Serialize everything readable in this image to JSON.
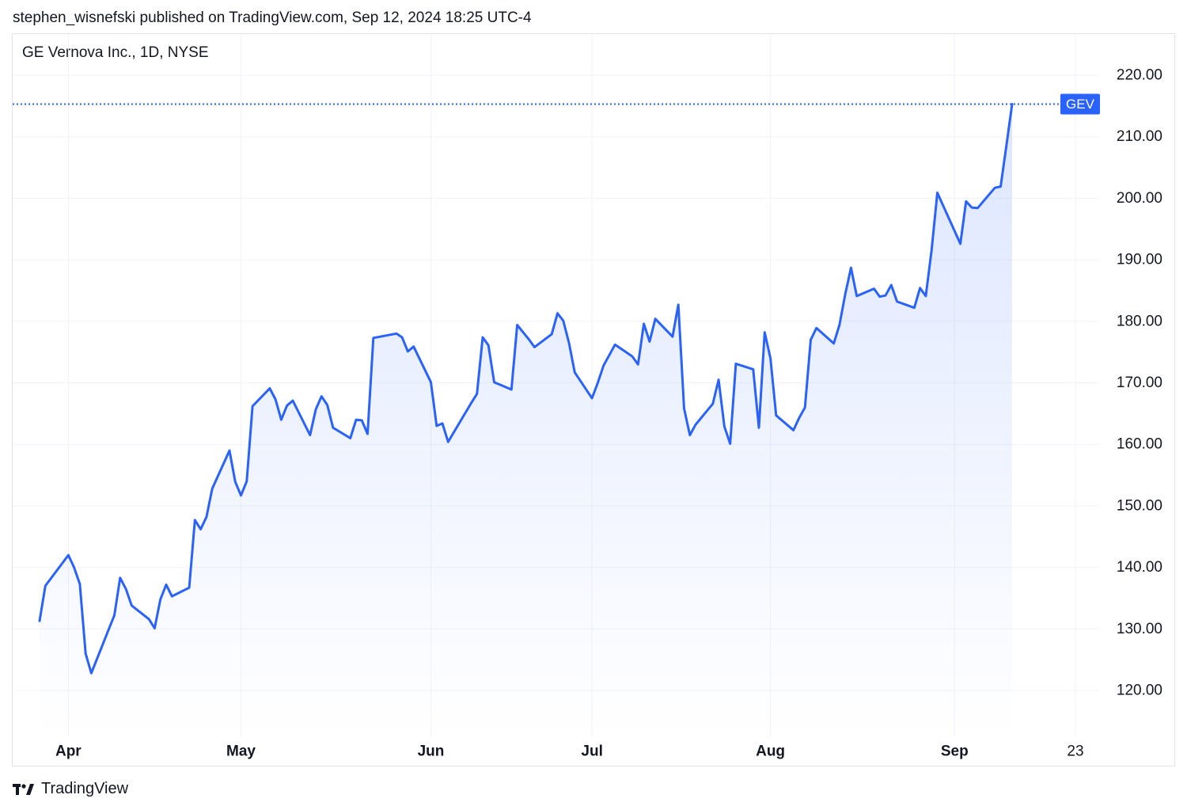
{
  "header": {
    "text": "stephen_wisnefski published on TradingView.com, Sep 12, 2024 18:25 UTC-4"
  },
  "symbol": {
    "title": "GE Vernova Inc., 1D, NYSE",
    "ticker": "GEV"
  },
  "footer": {
    "brand": "TradingView",
    "logo_icon": "tradingview-logo-icon"
  },
  "colors": {
    "line": "#2962ff",
    "grid": "#f0f3fa",
    "text": "#131722",
    "label_bg": "#2962ff"
  },
  "chart_data": {
    "type": "area",
    "series": [
      {
        "name": "GEV",
        "x": [
          "2024-03-27",
          "2024-03-28",
          "2024-04-01",
          "2024-04-02",
          "2024-04-03",
          "2024-04-04",
          "2024-04-05",
          "2024-04-08",
          "2024-04-09",
          "2024-04-10",
          "2024-04-11",
          "2024-04-12",
          "2024-04-15",
          "2024-04-16",
          "2024-04-17",
          "2024-04-18",
          "2024-04-19",
          "2024-04-22",
          "2024-04-23",
          "2024-04-24",
          "2024-04-25",
          "2024-04-26",
          "2024-04-29",
          "2024-04-30",
          "2024-05-01",
          "2024-05-02",
          "2024-05-03",
          "2024-05-06",
          "2024-05-07",
          "2024-05-08",
          "2024-05-09",
          "2024-05-10",
          "2024-05-13",
          "2024-05-14",
          "2024-05-15",
          "2024-05-16",
          "2024-05-17",
          "2024-05-20",
          "2024-05-21",
          "2024-05-22",
          "2024-05-23",
          "2024-05-24",
          "2024-05-28",
          "2024-05-29",
          "2024-05-30",
          "2024-05-31",
          "2024-06-03",
          "2024-06-04",
          "2024-06-05",
          "2024-06-06",
          "2024-06-07",
          "2024-06-10",
          "2024-06-11",
          "2024-06-12",
          "2024-06-13",
          "2024-06-14",
          "2024-06-17",
          "2024-06-18",
          "2024-06-20",
          "2024-06-21",
          "2024-06-24",
          "2024-06-25",
          "2024-06-26",
          "2024-06-27",
          "2024-06-28",
          "2024-07-01",
          "2024-07-02",
          "2024-07-03",
          "2024-07-05",
          "2024-07-08",
          "2024-07-09",
          "2024-07-10",
          "2024-07-11",
          "2024-07-12",
          "2024-07-15",
          "2024-07-16",
          "2024-07-17",
          "2024-07-18",
          "2024-07-19",
          "2024-07-22",
          "2024-07-23",
          "2024-07-24",
          "2024-07-25",
          "2024-07-26",
          "2024-07-29",
          "2024-07-30",
          "2024-07-31",
          "2024-08-01",
          "2024-08-02",
          "2024-08-05",
          "2024-08-06",
          "2024-08-07",
          "2024-08-08",
          "2024-08-09",
          "2024-08-12",
          "2024-08-13",
          "2024-08-14",
          "2024-08-15",
          "2024-08-16",
          "2024-08-19",
          "2024-08-20",
          "2024-08-21",
          "2024-08-22",
          "2024-08-23",
          "2024-08-26",
          "2024-08-27",
          "2024-08-28",
          "2024-08-29",
          "2024-08-30",
          "2024-09-03",
          "2024-09-04",
          "2024-09-05",
          "2024-09-06",
          "2024-09-09",
          "2024-09-10",
          "2024-09-11",
          "2024-09-12"
        ],
        "values": [
          131.3,
          137.0,
          142.0,
          140.0,
          137.3,
          126.0,
          122.8,
          129.9,
          132.2,
          138.3,
          136.5,
          133.8,
          131.6,
          130.1,
          134.8,
          137.2,
          135.3,
          136.7,
          147.7,
          146.2,
          148.2,
          152.8,
          159.0,
          153.9,
          151.7,
          154.0,
          166.2,
          169.1,
          167.3,
          164.0,
          166.3,
          167.1,
          161.5,
          165.7,
          167.8,
          166.4,
          162.7,
          161.0,
          164.0,
          163.9,
          161.7,
          177.3,
          178.0,
          177.4,
          175.1,
          175.9,
          170.1,
          163.0,
          163.4,
          160.4,
          162.0,
          166.7,
          168.2,
          177.4,
          176.1,
          170.1,
          168.9,
          179.4,
          177.1,
          175.8,
          177.9,
          181.3,
          180.1,
          176.5,
          171.7,
          167.5,
          170.0,
          172.8,
          176.2,
          174.3,
          173.0,
          179.6,
          176.7,
          180.4,
          177.5,
          182.7,
          165.8,
          161.5,
          163.2,
          166.6,
          170.5,
          162.9,
          160.1,
          173.1,
          172.2,
          162.7,
          178.2,
          174.0,
          164.7,
          162.3,
          164.3,
          166.0,
          177.0,
          178.9,
          176.4,
          179.4,
          184.4,
          188.7,
          184.1,
          185.3,
          184.0,
          184.2,
          185.9,
          183.2,
          182.2,
          185.4,
          184.1,
          191.5,
          200.9,
          192.6,
          199.5,
          198.5,
          198.4,
          201.7,
          201.9,
          208.5,
          215.3
        ]
      }
    ],
    "x_ticks": [
      "Apr",
      "May",
      "Jun",
      "Jul",
      "Aug",
      "Sep",
      "23"
    ],
    "y_ticks": [
      "120.00",
      "130.00",
      "140.00",
      "150.00",
      "160.00",
      "170.00",
      "180.00",
      "190.00",
      "200.00",
      "210.00",
      "220.00"
    ],
    "ylim": [
      120,
      220
    ],
    "last_value": 215.3,
    "last_label": "GEV",
    "grid": true,
    "title": "GE Vernova Inc., 1D, NYSE"
  }
}
